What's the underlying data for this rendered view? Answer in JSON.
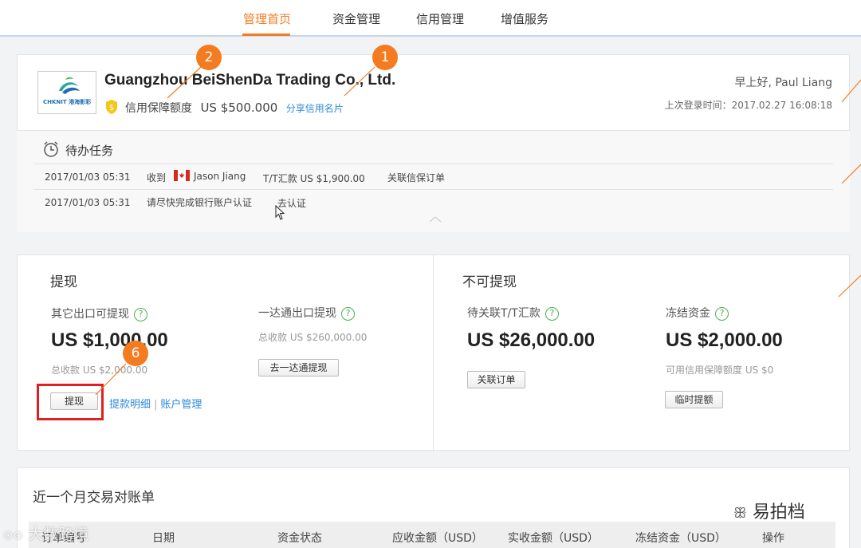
{
  "nav": {
    "tabs": [
      {
        "label": "管理首页",
        "active": true
      },
      {
        "label": "资金管理",
        "active": false
      },
      {
        "label": "信用管理",
        "active": false
      },
      {
        "label": "增值服务",
        "active": false
      }
    ]
  },
  "header": {
    "logo_text": "CHKNIT 港海影彩",
    "company_name": "Guangzhou BeiShenDa Trading Co., Ltd.",
    "credit_label": "信用保障额度",
    "credit_amount": "US $500.000",
    "share_link": "分享信用名片",
    "greeting": "早上好, Paul Liang",
    "last_login": "上次登录时间：2017.02.27 16:08:18"
  },
  "todo": {
    "title": "待办任务",
    "items": [
      {
        "time": "2017/01/03 05:31",
        "text1": "收到",
        "sender": "Jason Jiang",
        "detail": "T/T汇款 US $1,900.00",
        "action": "关联信保订单"
      },
      {
        "time": "2017/01/03 05:31",
        "text1": "请尽快完成银行账户认证",
        "action": "去认证"
      }
    ]
  },
  "withdraw": {
    "title": "提现",
    "other": {
      "label": "其它出口可提现",
      "amount": "US $1,000.00",
      "total": "总收款  US $2,000.00",
      "button": "提现",
      "detail_link": "提款明细",
      "account_link": "账户管理"
    },
    "yida": {
      "label": "一达通出口提现",
      "total": "总收款  US $260,000.00",
      "button": "去一达通提现"
    }
  },
  "nonwithdraw": {
    "title": "不可提现",
    "pending": {
      "label": "待关联T/T汇款",
      "amount": "US $26,000.00",
      "button": "关联订单"
    },
    "frozen": {
      "label": "冻结资金",
      "amount": "US $2,000.00",
      "available": "可用信用保障额度  US $0",
      "button": "临时提额"
    }
  },
  "statement": {
    "title": "近一个月交易对账单",
    "columns": [
      "订单编号",
      "日期",
      "资金状态",
      "应收金额（USD）",
      "实收金额（USD）",
      "冻结资金（USD）",
      "操作"
    ]
  },
  "callouts": [
    "1",
    "2",
    "6"
  ],
  "watermarks": {
    "left": "大数跨境",
    "right": "易拍档"
  },
  "colors": {
    "accent": "#f47b20",
    "link": "#2e8ad8",
    "help": "#4caf50",
    "highlight_box": "#e02020"
  }
}
